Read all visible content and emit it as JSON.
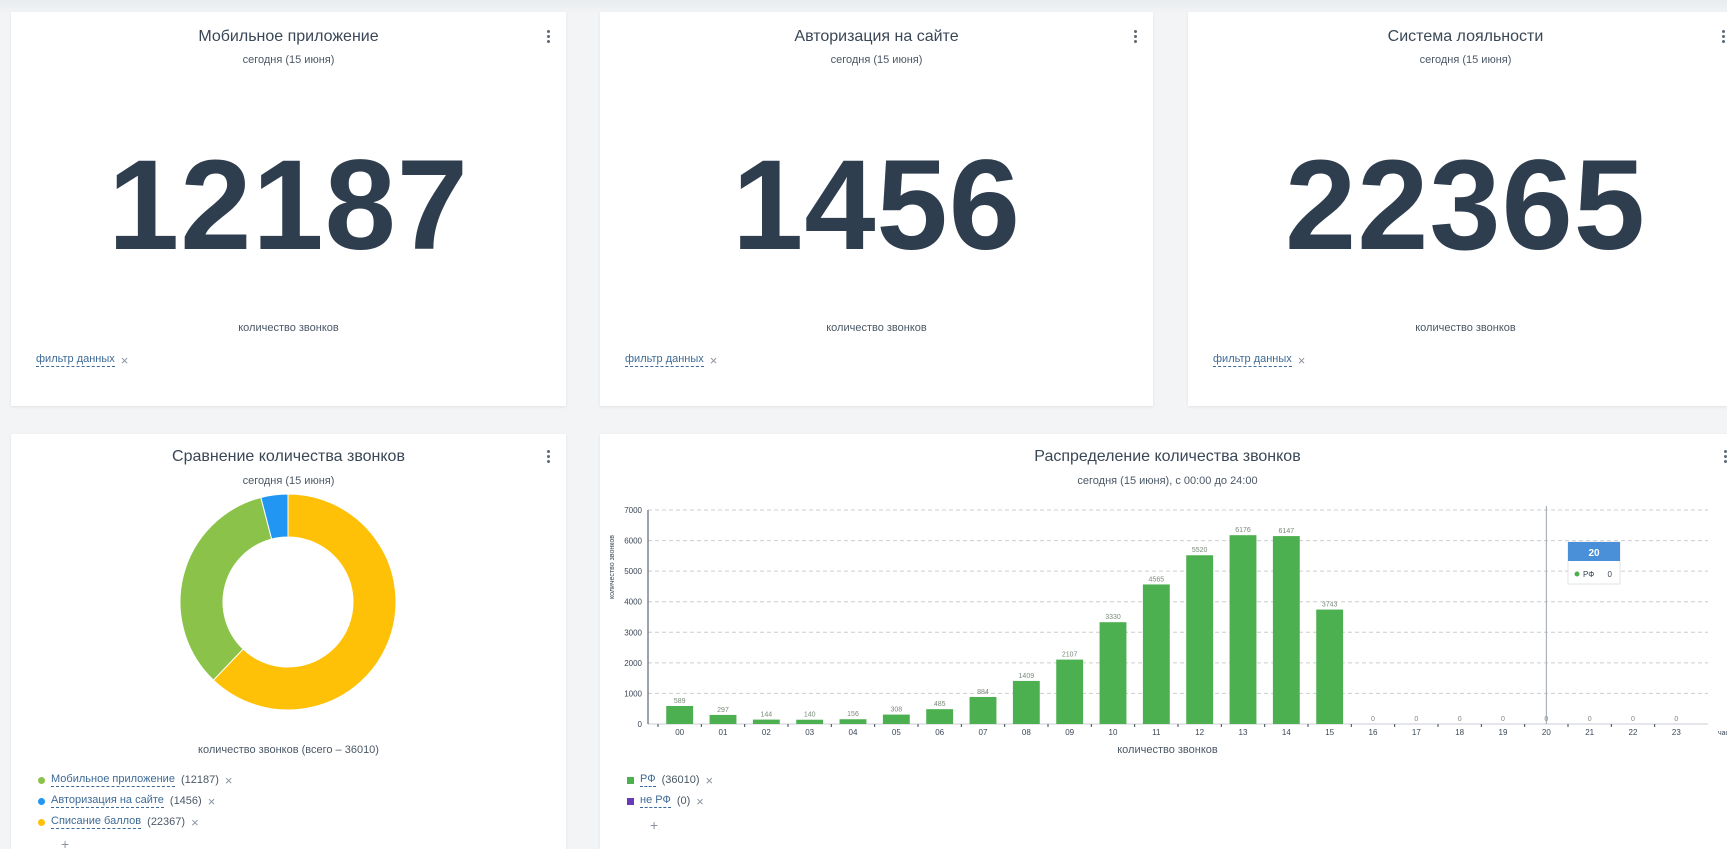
{
  "cards": [
    {
      "title": "Мобильное приложение",
      "subtitle": "сегодня (15 июня)",
      "value": "12187",
      "label": "количество звонков",
      "filter": "фильтр данных"
    },
    {
      "title": "Авторизация на сайте",
      "subtitle": "сегодня (15 июня)",
      "value": "1456",
      "label": "количество звонков",
      "filter": "фильтр данных"
    },
    {
      "title": "Система лояльности",
      "subtitle": "сегодня (15 июня)",
      "value": "22365",
      "label": "количество звонков",
      "filter": "фильтр данных"
    }
  ],
  "donut": {
    "title": "Сравнение количества звонков",
    "subtitle": "сегодня (15 июня)",
    "caption": "количество звонков (всего – 36010)",
    "legend": [
      {
        "label": "Мобильное приложение",
        "count": "(12187)",
        "color": "#8bc34a"
      },
      {
        "label": "Авторизация на сайте",
        "count": "(1456)",
        "color": "#2196f3"
      },
      {
        "label": "Списание баллов",
        "count": "(22367)",
        "color": "#ffc107"
      }
    ]
  },
  "bars": {
    "title": "Распределение количества звонков",
    "subtitle": "сегодня (15 июня), с 00:00 до 24:00",
    "xlabel": "количество звонков",
    "unit": "час",
    "tooltip": {
      "title": "20",
      "series": "РФ",
      "value": "0"
    },
    "legend": [
      {
        "label": "РФ",
        "count": "(36010)",
        "color": "#4caf50"
      },
      {
        "label": "не РФ",
        "count": "(0)",
        "color": "#673ab7"
      }
    ]
  },
  "chart_data": [
    {
      "type": "pie",
      "title": "Сравнение количества звонков",
      "subtitle": "сегодня (15 июня)",
      "categories": [
        "Мобильное приложение",
        "Авторизация на сайте",
        "Списание баллов"
      ],
      "values": [
        12187,
        1456,
        22367
      ],
      "colors": [
        "#8bc34a",
        "#2196f3",
        "#ffc107"
      ],
      "donut": true
    },
    {
      "type": "bar",
      "title": "Распределение количества звонков",
      "subtitle": "сегодня (15 июня), с 00:00 до 24:00",
      "xlabel": "час",
      "ylabel": "количество звонков",
      "categories": [
        "00",
        "01",
        "02",
        "03",
        "04",
        "05",
        "06",
        "07",
        "08",
        "09",
        "10",
        "11",
        "12",
        "13",
        "14",
        "15",
        "16",
        "17",
        "18",
        "19",
        "20",
        "21",
        "22",
        "23"
      ],
      "series": [
        {
          "name": "РФ",
          "color": "#4caf50",
          "values": [
            589,
            297,
            144,
            140,
            156,
            308,
            485,
            884,
            1409,
            2107,
            3330,
            4565,
            5520,
            6176,
            6147,
            3743,
            0,
            0,
            0,
            0,
            0,
            0,
            0,
            0
          ]
        }
      ],
      "ylim": [
        0,
        7000
      ],
      "yticks": [
        0,
        1000,
        2000,
        3000,
        4000,
        5000,
        6000,
        7000
      ],
      "grid": true
    }
  ]
}
